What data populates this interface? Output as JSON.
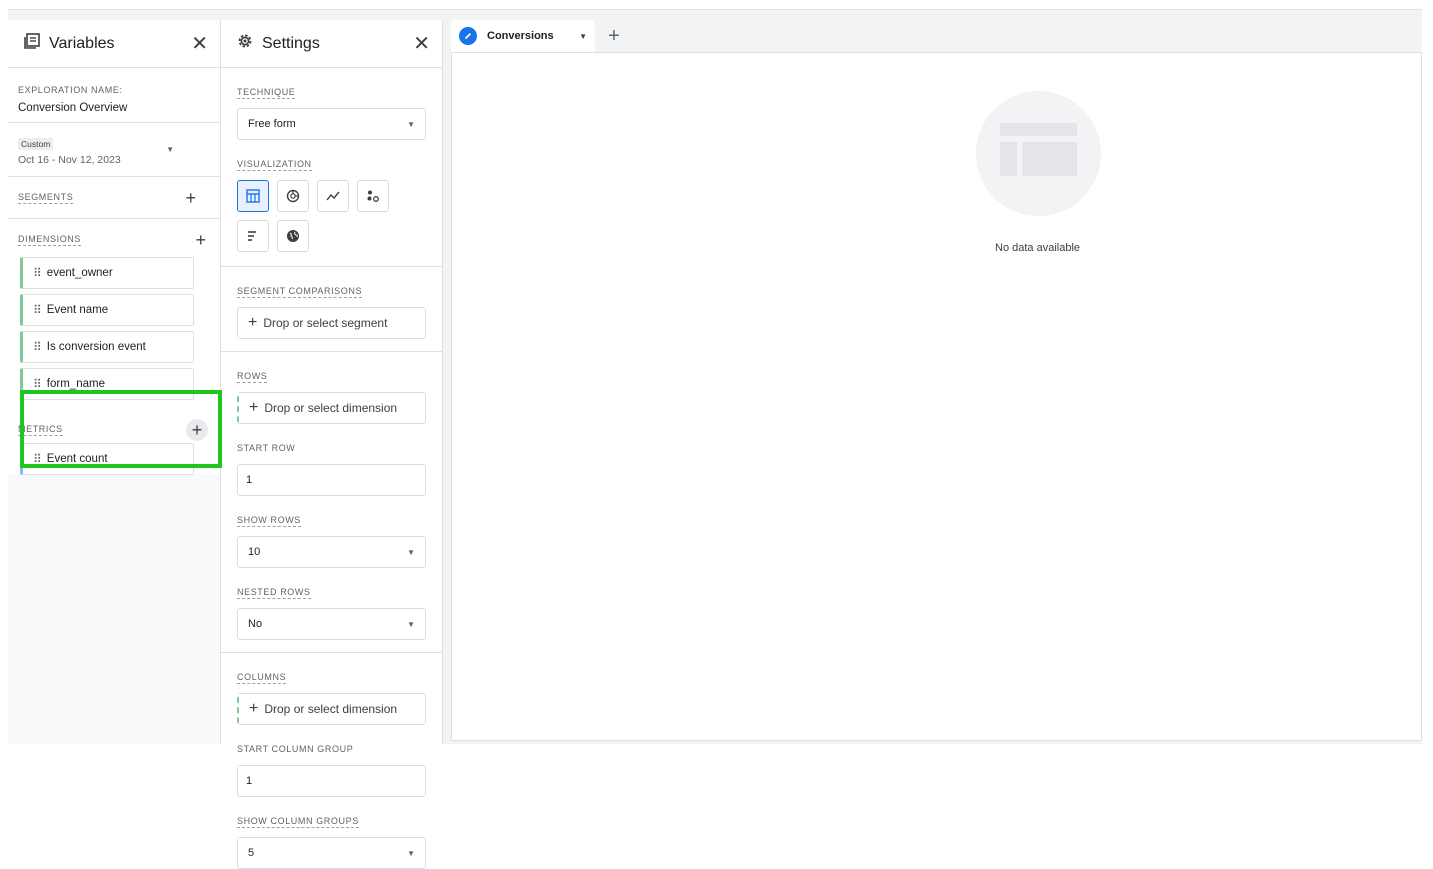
{
  "variables": {
    "title": "Variables",
    "exploration_label": "EXPLORATION NAME:",
    "exploration_name": "Conversion Overview",
    "date_chip": "Custom",
    "date_range": "Oct 16 - Nov 12, 2023",
    "segments_label": "SEGMENTS",
    "dimensions_label": "DIMENSIONS",
    "dimensions": [
      "event_owner",
      "Event name",
      "Is conversion event",
      "form_name"
    ],
    "metrics_label": "METRICS",
    "metrics": [
      "Event count"
    ]
  },
  "settings": {
    "title": "Settings",
    "technique_label": "TECHNIQUE",
    "technique_value": "Free form",
    "visualization_label": "VISUALIZATION",
    "visualizations": [
      "table-icon",
      "donut-icon",
      "line-icon",
      "scatter-icon",
      "bar-icon",
      "globe-icon"
    ],
    "segment_comparisons_label": "SEGMENT COMPARISONS",
    "segment_drop": "Drop or select segment",
    "rows_label": "ROWS",
    "rows_drop": "Drop or select dimension",
    "start_row_label": "START ROW",
    "start_row_value": "1",
    "show_rows_label": "SHOW ROWS",
    "show_rows_value": "10",
    "nested_rows_label": "NESTED ROWS",
    "nested_rows_value": "No",
    "columns_label": "COLUMNS",
    "columns_drop": "Drop or select dimension",
    "start_column_group_label": "START COLUMN GROUP",
    "start_column_group_value": "1",
    "show_column_groups_label": "SHOW COLUMN GROUPS",
    "show_column_groups_value": "5"
  },
  "canvas": {
    "tab_label": "Conversions",
    "empty_text": "No data available"
  },
  "colors": {
    "accent": "#1a73e8",
    "dimension_bar": "#81c995",
    "metric_bar": "#8ab4f8",
    "highlight": "#1ec71e"
  }
}
